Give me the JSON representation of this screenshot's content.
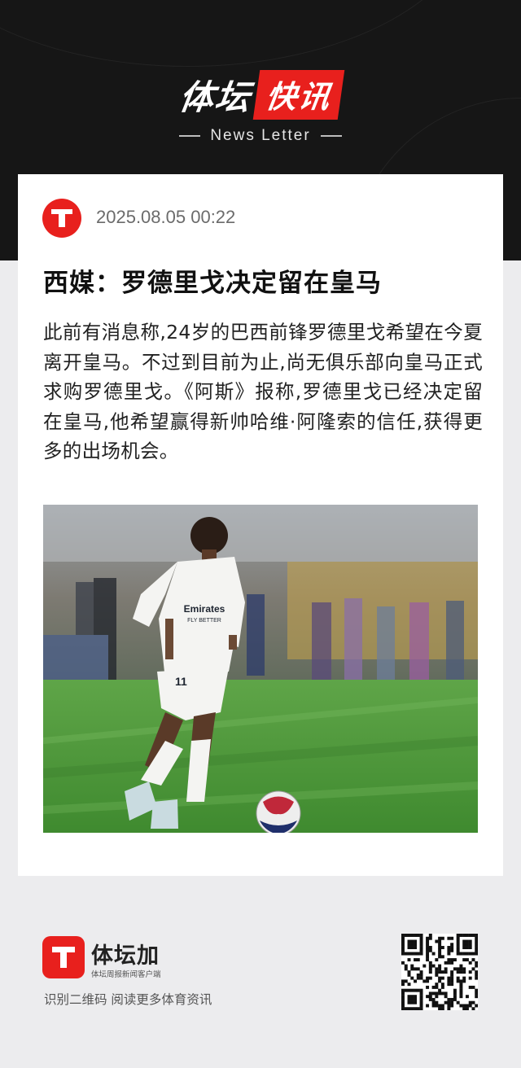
{
  "header": {
    "brand_left": "体坛",
    "brand_right": "快讯",
    "subtitle": "News Letter"
  },
  "article": {
    "timestamp": "2025.08.05 00:22",
    "title": "西媒：罗德里戈决定留在皇马",
    "body": "此前有消息称,24岁的巴西前锋罗德里戈希望在今夏离开皇马。不过到目前为止,尚无俱乐部向皇马正式求购罗德里戈。《阿斯》报称,罗德里戈已经决定留在皇马,他希望赢得新帅哈维·阿隆索的信任,获得更多的出场机会。",
    "photo_icon": "football-player-photo",
    "jersey_sponsor": "Emirates",
    "jersey_sponsor_sub": "FLY BETTER",
    "jersey_number": "11"
  },
  "footer": {
    "app_name": "体坛加",
    "app_tagline": "体坛周报新闻客户端",
    "scan_hint": "识别二维码 阅读更多体育资讯",
    "qr_icon": "qr-code-icon"
  },
  "colors": {
    "brand_red": "#e8201d",
    "header_bg": "#161616",
    "page_bg": "#ececee"
  }
}
